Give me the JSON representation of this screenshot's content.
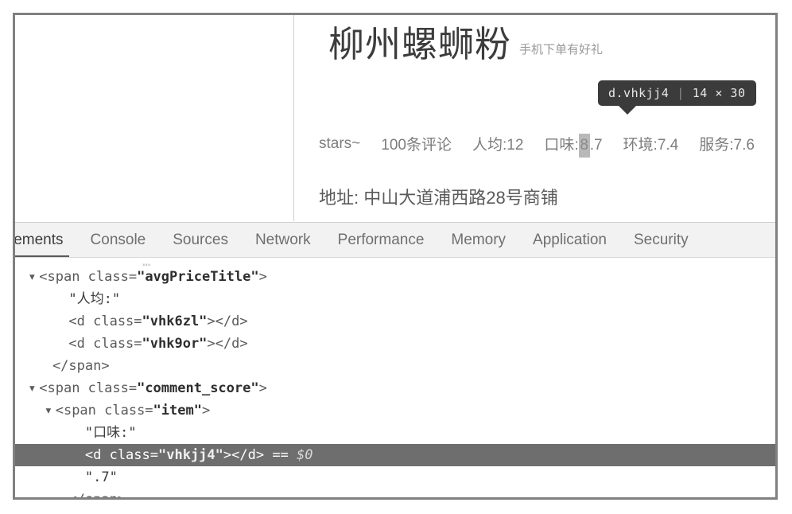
{
  "preview": {
    "shop": {
      "title": "柳州螺蛳粉",
      "subtitle": "手机下单有好礼",
      "rating": {
        "stars_label": "stars~",
        "review_count": "100条评论",
        "avg_price": "人均:12",
        "taste_label": "口味:",
        "taste_highlight_digit": "8",
        "taste_rest": ".7",
        "environment": "环境:7.4",
        "service": "服务:7.6"
      },
      "address": "地址: 中山大道浦西路28号商铺"
    }
  },
  "inspector_tooltip": {
    "selector": "d.vhkjj4",
    "separator": "|",
    "dimensions": "14 × 30"
  },
  "devtools": {
    "tabs": [
      {
        "label": "lements",
        "active": true
      },
      {
        "label": "Console",
        "active": false
      },
      {
        "label": "Sources",
        "active": false
      },
      {
        "label": "Network",
        "active": false
      },
      {
        "label": "Performance",
        "active": false
      },
      {
        "label": "Memory",
        "active": false
      },
      {
        "label": "Application",
        "active": false
      },
      {
        "label": "Security",
        "active": false
      }
    ],
    "dom_lines": [
      {
        "type": "clipped",
        "indent": 0,
        "text": "…"
      },
      {
        "type": "open-tag",
        "indent": 1,
        "twisty": "▾",
        "tag_open": "<span class=",
        "attr_value": "\"avgPriceTitle\"",
        "tag_close": ">"
      },
      {
        "type": "text",
        "indent": 3,
        "text": "\"人均:\""
      },
      {
        "type": "void-tag",
        "indent": 3,
        "tag_open": "<d class=",
        "attr_value": "\"vhk6zl\"",
        "tag_close": "></d>"
      },
      {
        "type": "void-tag",
        "indent": 3,
        "tag_open": "<d class=",
        "attr_value": "\"vhk9or\"",
        "tag_close": "></d>"
      },
      {
        "type": "close-tag",
        "indent": 2,
        "text": "</span>"
      },
      {
        "type": "open-tag",
        "indent": 1,
        "twisty": "▾",
        "tag_open": "<span class=",
        "attr_value": "\"comment_score\"",
        "tag_close": ">"
      },
      {
        "type": "open-tag",
        "indent": 2,
        "twisty": "▾",
        "tag_open": "<span class=",
        "attr_value": "\"item\"",
        "tag_close": ">"
      },
      {
        "type": "text",
        "indent": 4,
        "text": "\"口味:\""
      },
      {
        "type": "selected",
        "indent": 4,
        "tag_open": "<d class=",
        "attr_value": "\"vhkjj4\"",
        "tag_close": "></d>",
        "suffix": " == ",
        "dollar": "$0"
      },
      {
        "type": "text",
        "indent": 4,
        "text": "\".7\""
      },
      {
        "type": "close-tag",
        "indent": 3,
        "text": "</span>"
      }
    ]
  },
  "colors": {
    "frame_border": "#808080",
    "tooltip_bg": "#3b3b3b",
    "selected_row_bg": "#6e6e6e",
    "highlight_box": "#b9b9b9",
    "tabbar_bg": "#f2f2f2"
  }
}
